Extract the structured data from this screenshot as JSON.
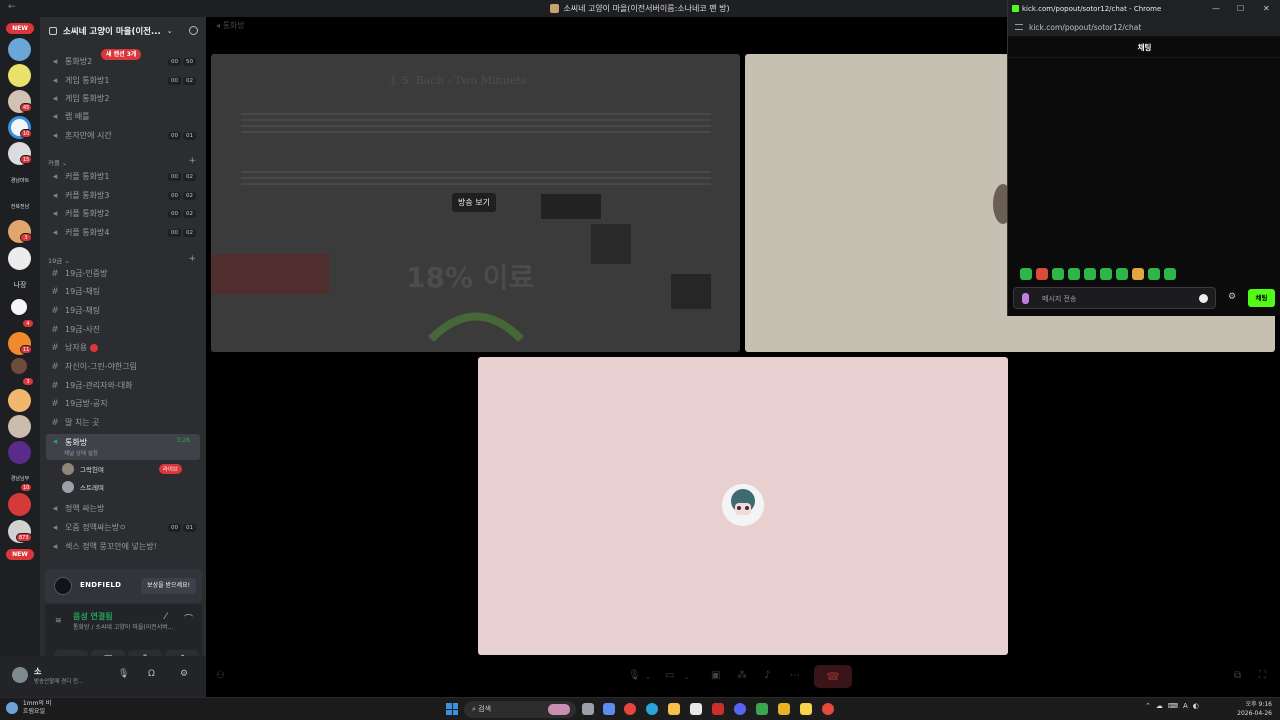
{
  "window": {
    "title": "소씨네 고양이 마을(이전서버이름:소나네코 팬 방)"
  },
  "rail": {
    "new_top": "NEW",
    "new_bottom": "NEW",
    "label_1": "경남마트",
    "label_2": "전북전남",
    "label_3": "나장",
    "label_4": "경남남부",
    "counts": [
      "45",
      "10",
      "15",
      "3",
      "4",
      "11",
      "3",
      "10",
      "873"
    ]
  },
  "server": {
    "name": "소씨네 고양이 마을(이전..."
  },
  "channels_top": [
    {
      "name": "통화방2",
      "a": "00",
      "b": "50",
      "badge": "새 캔션 3개"
    },
    {
      "name": "게임 통화방1",
      "a": "00",
      "b": "02"
    },
    {
      "name": "게임 통화방2"
    },
    {
      "name": "랩 배틀"
    },
    {
      "name": "혼자만에 시간",
      "a": "00",
      "b": "01"
    }
  ],
  "category_couple": "커플",
  "channels_couple": [
    {
      "name": "커플 통화방1",
      "a": "00",
      "b": "02"
    },
    {
      "name": "커플 통화방3",
      "a": "00",
      "b": "02"
    },
    {
      "name": "커플 통화방2",
      "a": "00",
      "b": "02"
    },
    {
      "name": "커플 통화방4",
      "a": "00",
      "b": "02"
    }
  ],
  "category_adult": "19금",
  "channels_text": [
    "19금-인증방",
    "19금-채팅",
    "19금-채팅",
    "19금-사진",
    "남자용",
    "자신이-그린-야한그림",
    "19금-관리자와-대화",
    "19금방-공지",
    "딸 치는 곳"
  ],
  "active_channel": {
    "name": "통화방",
    "status": "채널 상태 설정",
    "timer": "3:28"
  },
  "voice_users": [
    {
      "name": "그락헌며",
      "live": "라이브"
    },
    {
      "name": "스트레며"
    }
  ],
  "channels_bottom": [
    {
      "name": "정액 싸는방"
    },
    {
      "name": "오줌 정액싸는방ㅇ",
      "a": "00",
      "b": "01"
    },
    {
      "name": "섹스 정액 풍꼬안에 넣는방!"
    }
  ],
  "promo": {
    "brand": "ENDFIELD",
    "button": "보상을 받으세요!"
  },
  "voice_panel": {
    "status": "음성 연결됨",
    "channel": "통화방 / 소씨네 고양이 마을(이전서버..."
  },
  "user": {
    "name": "소",
    "status": "방송안할때 경디 전..."
  },
  "stage": {
    "title": "통화방",
    "watch_stream": "방송 보기",
    "sheet_title": "J. S. Bach - Two Minuets",
    "percent": "18% 이료"
  },
  "popup": {
    "title": "kick.com/popout/sotor12/chat - Chrome",
    "url": "kick.com/popout/sotor12/chat",
    "header": "채팅",
    "placeholder": "메시지 전송",
    "send": "채팅",
    "accent": "#53fc18"
  },
  "taskbar": {
    "weather_line1": "1mm의 비",
    "weather_line2": "흐림요일",
    "search": "검색",
    "time": "오후 9:16",
    "date": "2026-04-26"
  }
}
